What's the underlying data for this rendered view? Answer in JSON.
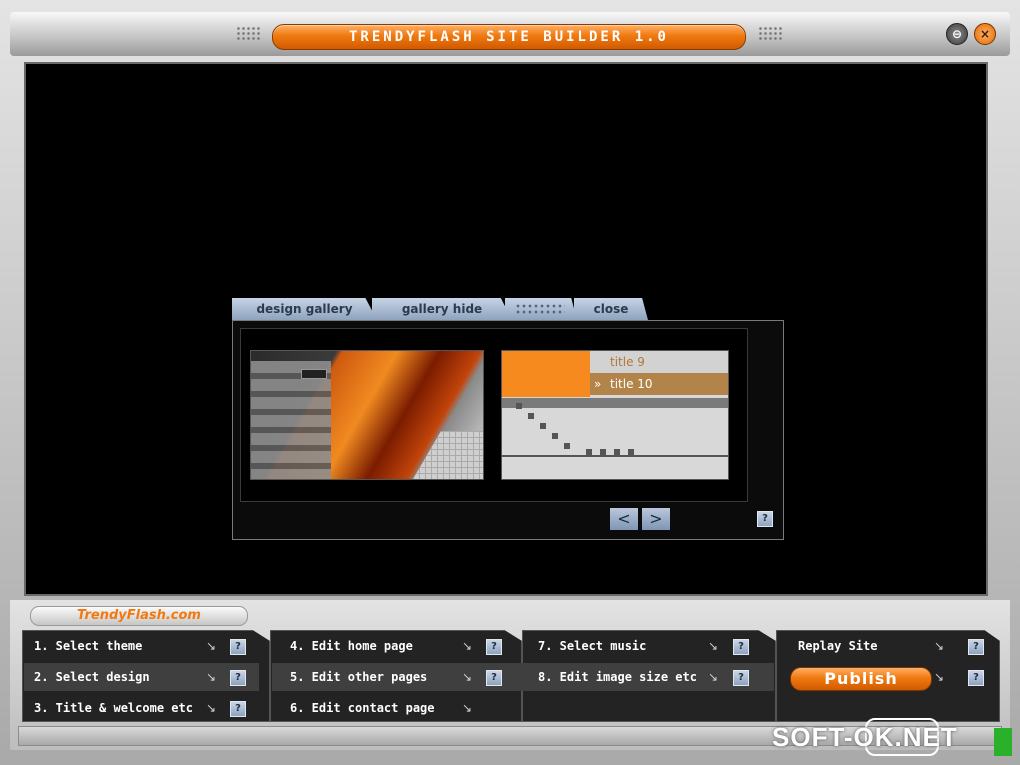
{
  "window": {
    "title": "TRENDYFLASH SITE BUILDER 1.0",
    "minimize_label": "⊖",
    "close_label": "×"
  },
  "gallery": {
    "tabs": [
      {
        "label": "design gallery"
      },
      {
        "label": "gallery hide"
      },
      {
        "label": "close"
      }
    ],
    "thumb2_rows": [
      {
        "marker": "",
        "label": "title 9"
      },
      {
        "marker": "»",
        "label": "title 10"
      }
    ],
    "prev_label": "<",
    "next_label": ">",
    "help_label": "?"
  },
  "bottom": {
    "brand": "TrendyFlash.com",
    "steps": [
      {
        "label": "1.  Select theme"
      },
      {
        "label": "2.  Select design"
      },
      {
        "label": "3.  Title & welcome etc"
      },
      {
        "label": "4.  Edit home page"
      },
      {
        "label": "5.  Edit other pages"
      },
      {
        "label": "6.  Edit contact page"
      },
      {
        "label": "7.  Select music"
      },
      {
        "label": "8.  Edit image size etc"
      }
    ],
    "replay_label": "Replay Site",
    "publish_label": "Publish",
    "help_label": "?"
  },
  "watermark": {
    "text": "SOFT-OK.NET"
  },
  "colors": {
    "accent": "#f07a10",
    "tab": "#a9bad0",
    "stage": "#000000"
  }
}
